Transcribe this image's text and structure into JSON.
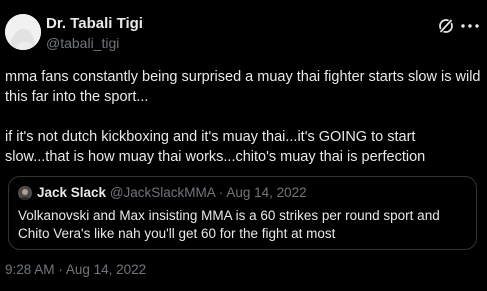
{
  "author": {
    "name": "Dr. Tabali Tigi",
    "handle": "@tabali_tigi"
  },
  "tweet": {
    "text": "mma fans constantly being surprised a muay thai fighter starts slow is wild this far into the sport...\n\nif it's not dutch kickboxing and it's muay thai...it's GOING to start slow...that is how muay thai works...chito's muay thai is perfection",
    "time": "9:28 AM",
    "separator": "·",
    "date": "Aug 14, 2022"
  },
  "quote": {
    "name": "Jack Slack",
    "handle": "@JackSlackMMA",
    "separator": "·",
    "date": "Aug 14, 2022",
    "text": "Volkanovski and Max insisting MMA is a 60 strikes per round sport and Chito Vera's like nah you'll get 60 for the fight at most"
  },
  "icons": {
    "logo": "x-logo-icon",
    "more": "more-options-icon"
  },
  "colors": {
    "background": "#000000",
    "text": "#e7e9ea",
    "secondary": "#71767b",
    "border": "#2f3336"
  }
}
